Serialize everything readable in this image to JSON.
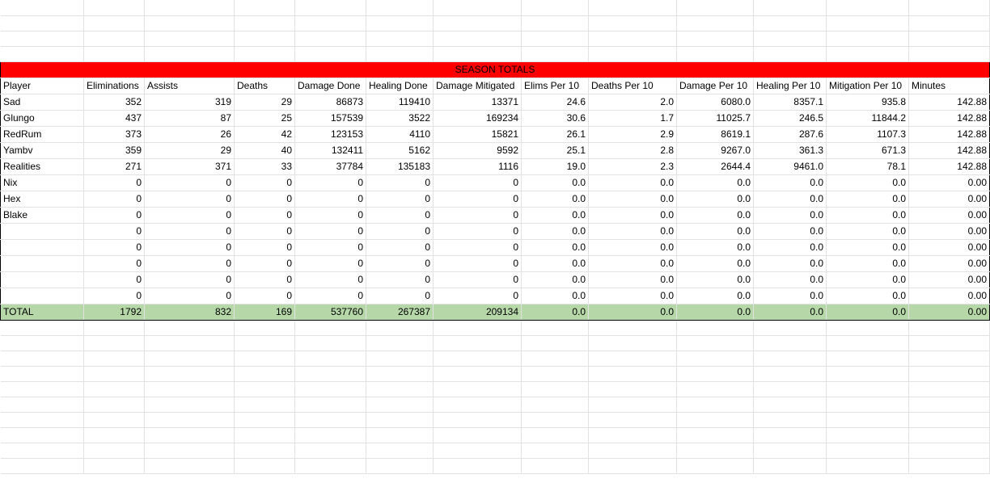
{
  "title": "SEASON TOTALS",
  "headers": [
    "Player",
    "Eliminations",
    "Assists",
    "Deaths",
    "Damage Done",
    "Healing Done",
    "Damage Mitigated",
    "Elims Per 10",
    "Deaths Per 10",
    "Damage Per 10",
    "Healing Per 10",
    "Mitigation Per 10",
    "Minutes"
  ],
  "rows": [
    [
      "Sad",
      "352",
      "319",
      "29",
      "86873",
      "119410",
      "13371",
      "24.6",
      "2.0",
      "6080.0",
      "8357.1",
      "935.8",
      "142.88"
    ],
    [
      "Glungo",
      "437",
      "87",
      "25",
      "157539",
      "3522",
      "169234",
      "30.6",
      "1.7",
      "11025.7",
      "246.5",
      "11844.2",
      "142.88"
    ],
    [
      "RedRum",
      "373",
      "26",
      "42",
      "123153",
      "4110",
      "15821",
      "26.1",
      "2.9",
      "8619.1",
      "287.6",
      "1107.3",
      "142.88"
    ],
    [
      "Yambv",
      "359",
      "29",
      "40",
      "132411",
      "5162",
      "9592",
      "25.1",
      "2.8",
      "9267.0",
      "361.3",
      "671.3",
      "142.88"
    ],
    [
      "Realities",
      "271",
      "371",
      "33",
      "37784",
      "135183",
      "1116",
      "19.0",
      "2.3",
      "2644.4",
      "9461.0",
      "78.1",
      "142.88"
    ],
    [
      "Nix",
      "0",
      "0",
      "0",
      "0",
      "0",
      "0",
      "0.0",
      "0.0",
      "0.0",
      "0.0",
      "0.0",
      "0.00"
    ],
    [
      "Hex",
      "0",
      "0",
      "0",
      "0",
      "0",
      "0",
      "0.0",
      "0.0",
      "0.0",
      "0.0",
      "0.0",
      "0.00"
    ],
    [
      "Blake",
      "0",
      "0",
      "0",
      "0",
      "0",
      "0",
      "0.0",
      "0.0",
      "0.0",
      "0.0",
      "0.0",
      "0.00"
    ],
    [
      "",
      "0",
      "0",
      "0",
      "0",
      "0",
      "0",
      "0.0",
      "0.0",
      "0.0",
      "0.0",
      "0.0",
      "0.00"
    ],
    [
      "",
      "0",
      "0",
      "0",
      "0",
      "0",
      "0",
      "0.0",
      "0.0",
      "0.0",
      "0.0",
      "0.0",
      "0.00"
    ],
    [
      "",
      "0",
      "0",
      "0",
      "0",
      "0",
      "0",
      "0.0",
      "0.0",
      "0.0",
      "0.0",
      "0.0",
      "0.00"
    ],
    [
      "",
      "0",
      "0",
      "0",
      "0",
      "0",
      "0",
      "0.0",
      "0.0",
      "0.0",
      "0.0",
      "0.0",
      "0.00"
    ],
    [
      "",
      "0",
      "0",
      "0",
      "0",
      "0",
      "0",
      "0.0",
      "0.0",
      "0.0",
      "0.0",
      "0.0",
      "0.00"
    ]
  ],
  "total": [
    "TOTAL",
    "1792",
    "832",
    "169",
    "537760",
    "267387",
    "209134",
    "0.0",
    "0.0",
    "0.0",
    "0.0",
    "0.0",
    "0.00"
  ],
  "colors": {
    "title_bg": "#ff0000",
    "total_bg": "#b6d7a8",
    "gridline": "#e2e2e2"
  }
}
